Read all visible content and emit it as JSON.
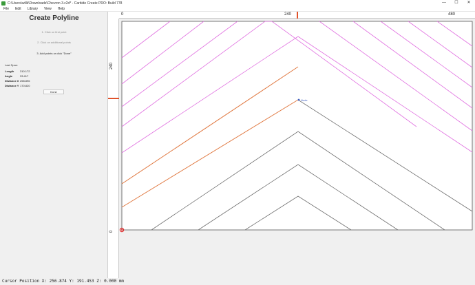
{
  "window": {
    "title": "C:\\Users\\willk\\Downloads\\Chevron 3.c2d* - Carbide Create PRO: Build 778",
    "controls": [
      "—",
      "☐",
      "✕"
    ]
  },
  "menu": [
    "File",
    "Edit",
    "Library",
    "View",
    "Help"
  ],
  "panel": {
    "title": "Create Polyline",
    "steps": [
      "1. Click on first point",
      "2. Click on additional points",
      "3. Add points or click \"Done\""
    ],
    "last_span_label": "Last Span:",
    "stats": [
      {
        "label": "Length",
        "value": "310.172"
      },
      {
        "label": "Angle",
        "value": "33.417"
      },
      {
        "label": "Distance X",
        "value": "258.896"
      },
      {
        "label": "Distance Y",
        "value": "170.820"
      }
    ],
    "done_label": "Done"
  },
  "ruler": {
    "top_labels": [
      "0",
      "240",
      "480"
    ],
    "left_labels": [
      "240",
      "0"
    ]
  },
  "canvas": {
    "node_label": "Node",
    "colors": {
      "board": "#ffffff",
      "magenta": "#e070e0",
      "orange": "#e07840",
      "gray": "#707070",
      "node": "#4060c0",
      "origin": "#e02020"
    }
  },
  "status": {
    "cursor_position": "Cursor Position X: 256.874 Y: 191.453 Z: 0.000 mm"
  }
}
